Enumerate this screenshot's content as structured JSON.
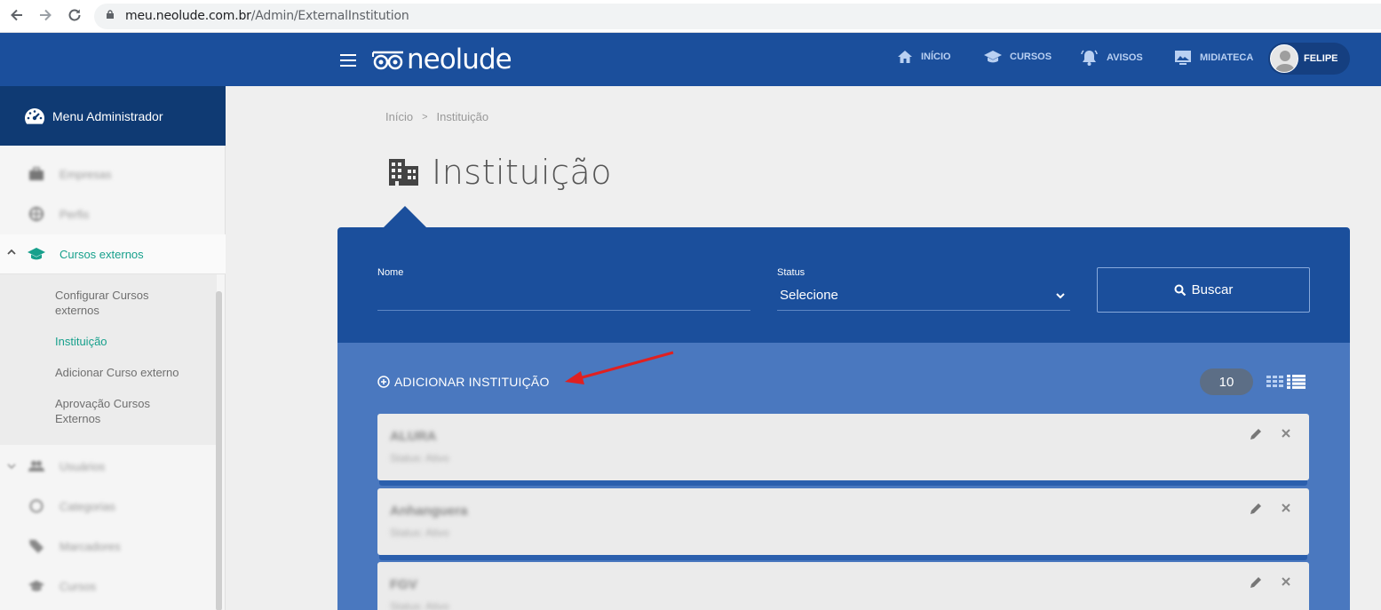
{
  "browser": {
    "url_host": "meu.neolude.com.br",
    "url_path": "/Admin/ExternalInstitution"
  },
  "topbar": {
    "logo_text": "neolude",
    "nav": [
      {
        "label": "INÍCIO",
        "icon": "home-icon"
      },
      {
        "label": "CURSOS",
        "icon": "graduation-cap-icon"
      },
      {
        "label": "AVISOS",
        "icon": "bell-icon"
      },
      {
        "label": "MIDIATECA",
        "icon": "image-icon"
      }
    ],
    "user_name": "FELIPE"
  },
  "sidebar": {
    "header_title": "Menu Administrador",
    "items_top": [
      {
        "label": "Empresas",
        "icon": "briefcase-icon"
      },
      {
        "label": "Perfis",
        "icon": "globe-icon"
      }
    ],
    "active_section": "Cursos externos",
    "sub_items": [
      {
        "label": "Configurar Cursos externos",
        "active": false
      },
      {
        "label": "Instituição",
        "active": true
      },
      {
        "label": "Adicionar Curso externo",
        "active": false
      },
      {
        "label": "Aprovação Cursos Externos",
        "active": false
      }
    ],
    "items_bottom": [
      {
        "label": "Usuários",
        "icon": "users-icon"
      },
      {
        "label": "Categorias",
        "icon": "circle-icon"
      },
      {
        "label": "Marcadores",
        "icon": "tag-icon"
      },
      {
        "label": "Cursos",
        "icon": "graduation-cap-icon"
      }
    ]
  },
  "breadcrumb": {
    "home": "Início",
    "separator": ">",
    "current": "Instituição"
  },
  "page_title": "Instituição",
  "filters": {
    "name_label": "Nome",
    "name_value": "",
    "status_label": "Status",
    "status_value": "Selecione",
    "search_button": "Buscar"
  },
  "list": {
    "add_label": "ADICIONAR INSTITUIÇÃO",
    "page_size": "10",
    "items": [
      {
        "name": "ALURA",
        "status": "Status: Ativo"
      },
      {
        "name": "Anhanguera",
        "status": "Status: Ativo"
      },
      {
        "name": "FGV",
        "status": "Status: Ativo"
      }
    ]
  },
  "colors": {
    "brand_blue": "#1b4f9c",
    "list_blue": "#4a78bf",
    "accent_teal": "#17a08c",
    "annotation_red": "#e02020"
  }
}
